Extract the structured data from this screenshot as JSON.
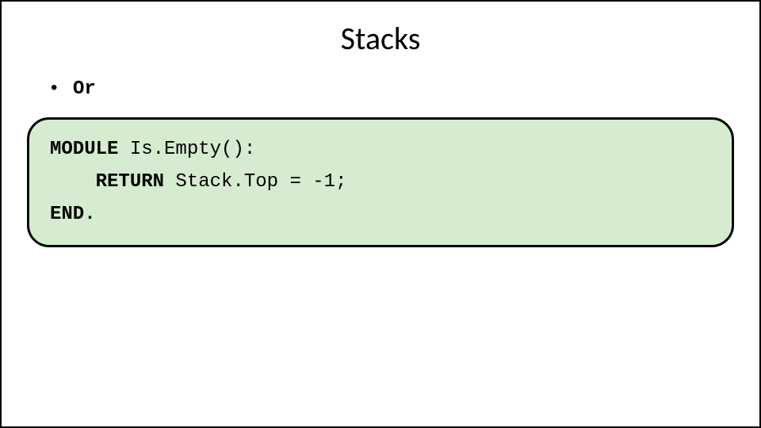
{
  "title": "Stacks",
  "bullet": "Or",
  "code": {
    "module_kw": "MODULE",
    "module_rest": " Is.Empty():",
    "indent": "    ",
    "return_kw": "RETURN",
    "return_rest": " Stack.Top = -1;",
    "end_kw": "END."
  }
}
